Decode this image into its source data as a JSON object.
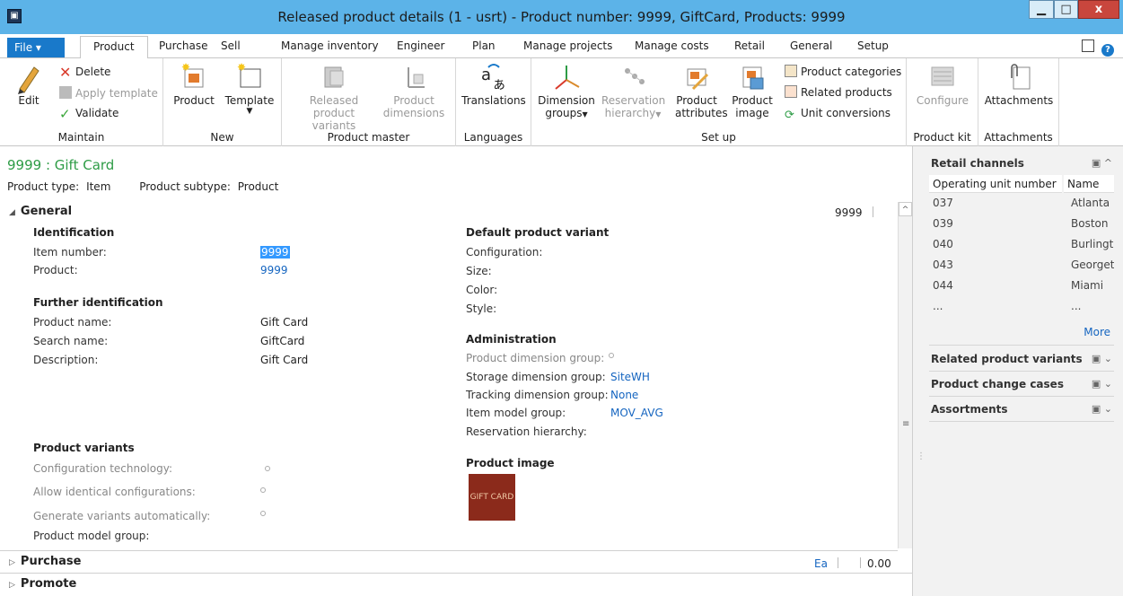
{
  "window": {
    "title": "Released product details (1 - usrt) - Product number: 9999, GiftCard, Products: 9999",
    "app_icon": "dynamics-ax-icon",
    "controls": {
      "minimize": "▁",
      "maximize": "□",
      "close": "x"
    }
  },
  "tabs": {
    "file": "File",
    "items": [
      "Product",
      "Purchase",
      "Sell",
      "Manage inventory",
      "Engineer",
      "Plan",
      "Manage projects",
      "Manage costs",
      "Retail",
      "General",
      "Setup"
    ],
    "active": "Product"
  },
  "ribbon": {
    "maintain": {
      "label": "Maintain",
      "edit": "Edit",
      "delete": "Delete",
      "apply_template": "Apply template",
      "validate": "Validate"
    },
    "new": {
      "label": "New",
      "product": "Product",
      "template": "Template"
    },
    "product_master": {
      "label": "Product master",
      "released_variants_1": "Released product",
      "released_variants_2": "variants",
      "dimensions_1": "Product",
      "dimensions_2": "dimensions"
    },
    "languages": {
      "label": "Languages",
      "translations": "Translations"
    },
    "setup": {
      "label": "Set up",
      "dimension_groups_1": "Dimension",
      "dimension_groups_2": "groups",
      "reservation_1": "Reservation",
      "reservation_2": "hierarchy",
      "attributes_1": "Product",
      "attributes_2": "attributes",
      "image_1": "Product",
      "image_2": "image",
      "categories": "Product categories",
      "related": "Related products",
      "unit_conversions": "Unit conversions"
    },
    "product_kit": {
      "label": "Product kit",
      "configure": "Configure"
    },
    "attachments": {
      "label": "Attachments",
      "attachments": "Attachments"
    }
  },
  "header": {
    "title": "9999 : Gift Card",
    "product_type_label": "Product type:",
    "product_type": "Item",
    "product_subtype_label": "Product subtype:",
    "product_subtype": "Product"
  },
  "general": {
    "title": "General",
    "summary": "9999",
    "identification": {
      "title": "Identification",
      "item_number_label": "Item number:",
      "item_number": "9999",
      "product_label": "Product:",
      "product": "9999"
    },
    "further": {
      "title": "Further identification",
      "product_name_label": "Product name:",
      "product_name": "Gift Card",
      "search_name_label": "Search name:",
      "search_name": "GiftCard",
      "description_label": "Description:",
      "description": "Gift Card"
    },
    "variants": {
      "title": "Product variants",
      "config_tech_label": "Configuration technology:",
      "allow_identical_label": "Allow identical configurations:",
      "generate_label": "Generate variants automatically:",
      "model_group_label": "Product model group:"
    },
    "default_variant": {
      "title": "Default product variant",
      "configuration_label": "Configuration:",
      "size_label": "Size:",
      "color_label": "Color:",
      "style_label": "Style:"
    },
    "administration": {
      "title": "Administration",
      "pdg_label": "Product dimension group:",
      "sdg_label": "Storage dimension group:",
      "sdg": "SiteWH",
      "tdg_label": "Tracking dimension group:",
      "tdg": "None",
      "img_label": "Item model group:",
      "img": "MOV_AVG",
      "reservation_label": "Reservation hierarchy:"
    },
    "product_image": {
      "title": "Product image",
      "image_text": "GIFT CARD"
    }
  },
  "purchase": {
    "title": "Purchase",
    "unit": "Ea",
    "price": "0.00"
  },
  "promote": {
    "title": "Promote"
  },
  "right_pane": {
    "retail_channels": {
      "title": "Retail channels",
      "columns": [
        "Operating unit number",
        "Name"
      ],
      "rows": [
        [
          "037",
          "Atlanta"
        ],
        [
          "039",
          "Boston"
        ],
        [
          "040",
          "Burlingto"
        ],
        [
          "043",
          "Georgeto"
        ],
        [
          "044",
          "Miami"
        ],
        [
          "...",
          "..."
        ]
      ],
      "more": "More"
    },
    "related_variants": "Related product variants",
    "change_cases": "Product change cases",
    "assortments": "Assortments"
  },
  "colors": {
    "title_bar": "#5cb3e8",
    "file_tab": "#1979ca",
    "link": "#1565c0",
    "page_title": "#2e9c46",
    "close": "#c9463d"
  }
}
